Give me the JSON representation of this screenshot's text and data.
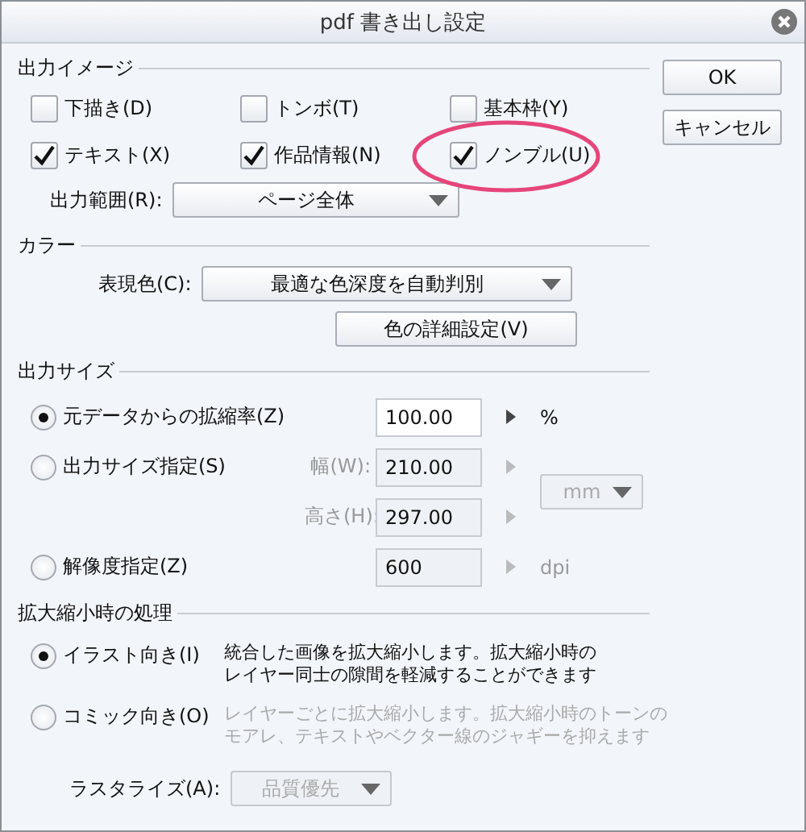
{
  "window": {
    "title": "pdf 書き出し設定"
  },
  "buttons": [
    {
      "label": "OK"
    },
    {
      "label": "キャンセル"
    }
  ],
  "output_image": {
    "heading": "出力イメージ",
    "checkboxes": [
      {
        "label": "下描き(D)",
        "checked": false,
        "highlighted": false
      },
      {
        "label": "トンボ(T)",
        "checked": false,
        "highlighted": false
      },
      {
        "label": "基本枠(Y)",
        "checked": false,
        "highlighted": false
      },
      {
        "label": "テキスト(X)",
        "checked": true,
        "highlighted": false
      },
      {
        "label": "作品情報(N)",
        "checked": true,
        "highlighted": false
      },
      {
        "label": "ノンブル(U)",
        "checked": true,
        "highlighted": true
      }
    ],
    "range": {
      "label": "出力範囲(R):",
      "value": "ページ全体"
    }
  },
  "color": {
    "heading": "カラー",
    "mode": {
      "label": "表現色(C):",
      "value": "最適な色深度を自動判別"
    },
    "detail_button": "色の詳細設定(V)"
  },
  "output_size": {
    "heading": "出力サイズ",
    "rows": [
      {
        "kind": "radio",
        "label": "元データからの拡縮率(Z)",
        "selected": true,
        "value": "100.00",
        "disabled": false,
        "unit": "%"
      },
      {
        "kind": "radio",
        "label": "出力サイズ指定(S)",
        "selected": false,
        "field_label": "幅(W):",
        "value": "210.00",
        "disabled": true
      },
      {
        "kind": "sub",
        "field_label": "高さ(H):",
        "value": "297.00",
        "disabled": true
      },
      {
        "kind": "radio",
        "label": "解像度指定(Z)",
        "selected": false,
        "value": "600",
        "disabled": true,
        "unit": "dpi"
      }
    ],
    "unit_select": {
      "value": "mm",
      "disabled": true
    }
  },
  "scaling": {
    "heading": "拡大縮小時の処理",
    "options": [
      {
        "label": "イラスト向き(I)",
        "selected": true,
        "description": [
          "統合した画像を拡大縮小します。拡大縮小時の",
          "レイヤー同士の隙間を軽減することができます"
        ]
      },
      {
        "label": "コミック向き(O)",
        "selected": false,
        "description": [
          "レイヤーごとに拡大縮小します。拡大縮小時のトーンの",
          "モアレ、テキストやベクター線のジャギーを抑えます"
        ]
      }
    ],
    "rasterize": {
      "label": "ラスタライズ(A):",
      "value": "品質優先",
      "disabled": true
    }
  }
}
